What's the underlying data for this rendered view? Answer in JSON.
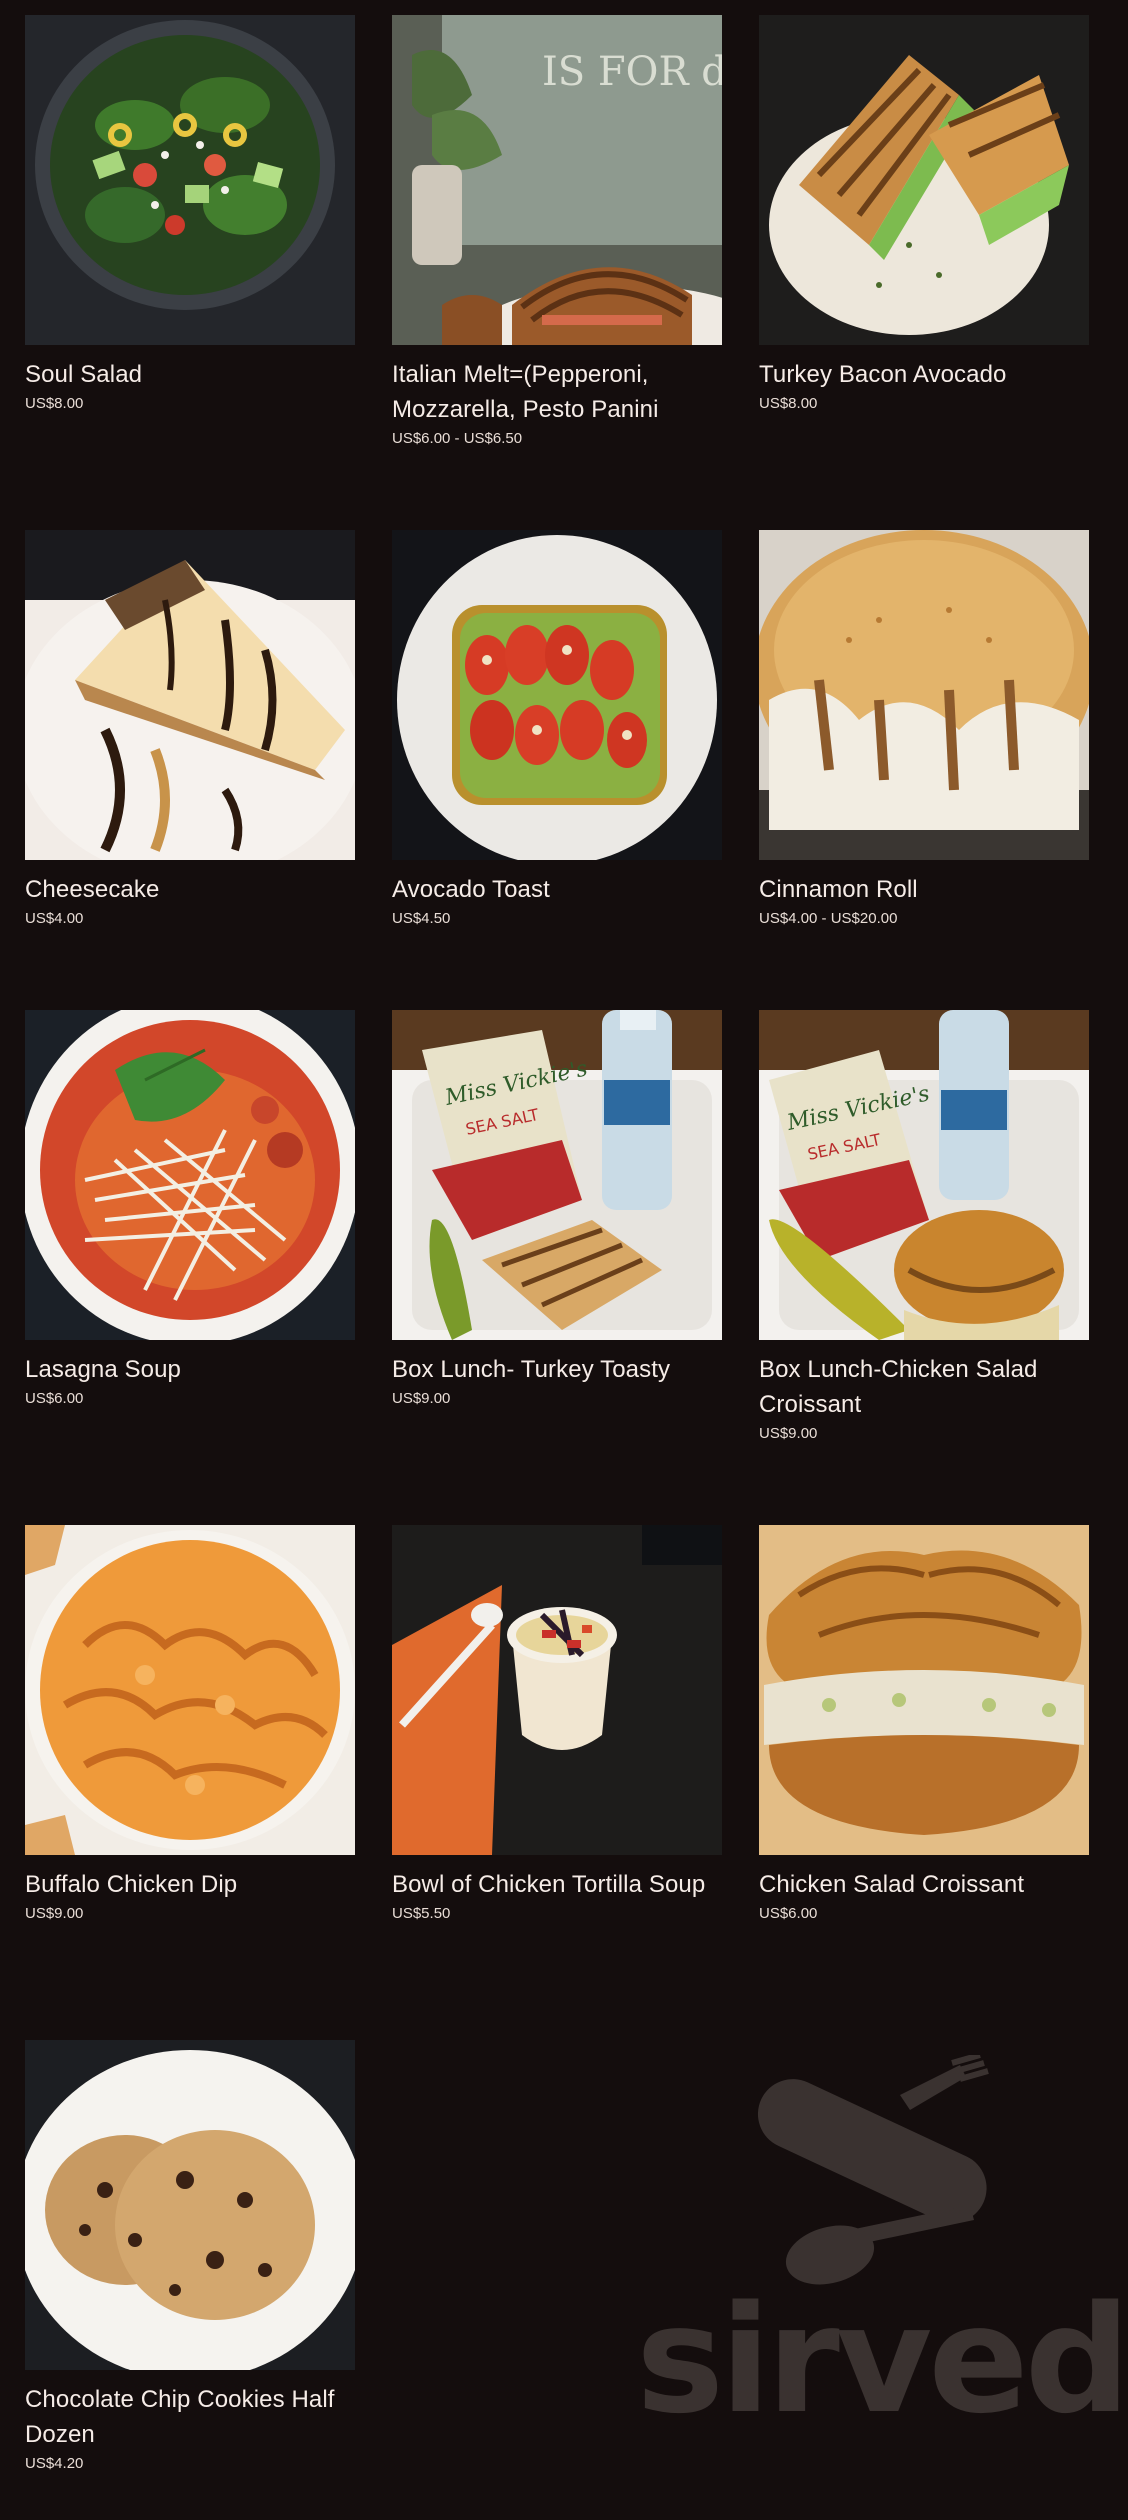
{
  "items": [
    {
      "name": "Soul Salad",
      "price": "US$8.00"
    },
    {
      "name": "Italian Melt=(Pepperoni, Mozzarella, Pesto Panini",
      "price": "US$6.00 - US$6.50"
    },
    {
      "name": "Turkey Bacon Avocado",
      "price": "US$8.00"
    },
    {
      "name": "Cheesecake",
      "price": "US$4.00"
    },
    {
      "name": "Avocado Toast",
      "price": "US$4.50"
    },
    {
      "name": "Cinnamon Roll",
      "price": "US$4.00 - US$20.00"
    },
    {
      "name": "Lasagna Soup",
      "price": "US$6.00"
    },
    {
      "name": "Box Lunch- Turkey Toasty",
      "price": "US$9.00"
    },
    {
      "name": "Box Lunch-Chicken Salad Croissant",
      "price": "US$9.00"
    },
    {
      "name": "Buffalo Chicken Dip",
      "price": "US$9.00"
    },
    {
      "name": "Bowl of Chicken Tortilla Soup",
      "price": "US$5.50"
    },
    {
      "name": "Chicken Salad Croissant",
      "price": "US$6.00"
    },
    {
      "name": "Chocolate Chip Cookies Half Dozen",
      "price": "US$4.20"
    }
  ],
  "photo_signs": {
    "italian_melt_sign": "IS FOR dancing",
    "chips_brand": "Miss Vickie's",
    "chips_flavor": "SEA SALT"
  },
  "brand": {
    "logo_text": "sirved"
  },
  "colors": {
    "background": "#140d0d",
    "text": "#f6ece7",
    "logo": "#3a3230"
  }
}
